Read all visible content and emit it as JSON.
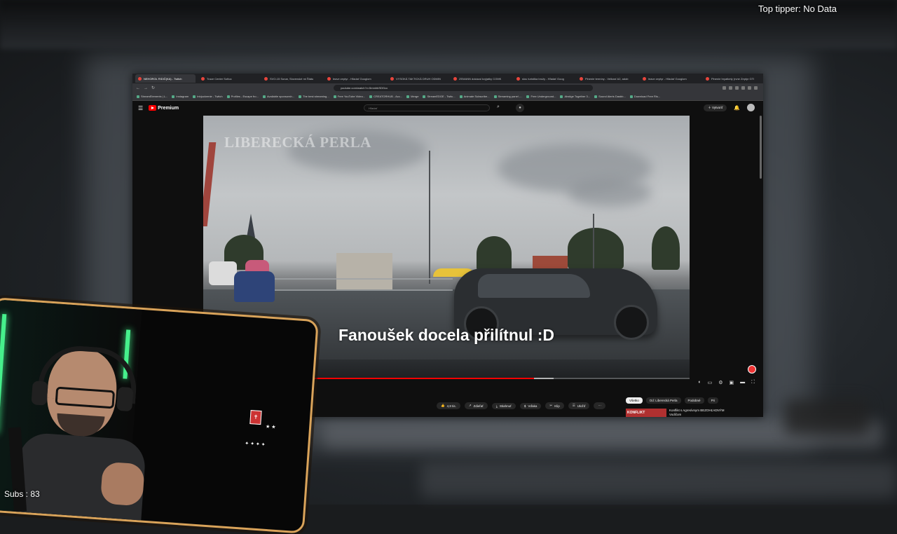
{
  "overlay": {
    "top_tipper": "Top tipper: No Data",
    "subs": "Subs : 83"
  },
  "browser": {
    "tabs": [
      {
        "label": "NEHOROL RIDIČ(KA) - Twitch",
        "active": true
      },
      {
        "label": "Trace Center Sofica",
        "active": false
      },
      {
        "label": "SVO-15 Sonar, Slovenské mi Štátu",
        "active": false
      },
      {
        "label": "leave zeptyr - Hľadať Googlom",
        "active": false
      },
      {
        "label": "VYSOKÁ TAKTICKÁ DRUH ODMIN",
        "active": false
      },
      {
        "label": "ZEMANN dokázal kvýjatky COMK",
        "active": false
      },
      {
        "label": "slou turistika brožy - Hľadať Goog",
        "active": false
      },
      {
        "label": "Plnenie termíny - Velkosť A2, adob",
        "active": false
      },
      {
        "label": "leave zeptyr - Hľadať Googlom",
        "active": false
      },
      {
        "label": "Plnenie hryatkety (rvne Zeptyr GTI",
        "active": false
      }
    ],
    "url": "youtube.com/watch?v=5mmhbSDf1vc",
    "bookmarks": [
      "StreamElements | L...",
      "Instagram",
      "Inbjuckrenie - Twitch",
      "Profiles - Escape fro...",
      "Available sponsorsh...",
      "The best streaming...",
      "Free YouTube Video...",
      "CREATORHUB - Acc...",
      "Merge",
      "StreamEDGE - Twitc...",
      "Animate Subscribe...",
      "Streaming panel -...",
      "Free Underground...",
      "Abstige Together 3...",
      "Sound Alerts Dasbb...",
      "Download Free Ris..."
    ]
  },
  "youtube": {
    "brand": "Premium",
    "search_placeholder": "Hľadať",
    "create_label": "Vytvoriť",
    "video": {
      "watermark": "LIBERECKÁ PERLA",
      "subtitle": "Fanoušek docela přilítnul :D",
      "progress": 0.68,
      "buffered": 0.72
    },
    "actions": [
      {
        "icon": "thumbs-up-icon",
        "label": "4,8 tis."
      },
      {
        "icon": "share-icon",
        "label": "Zdieľať"
      },
      {
        "icon": "download-icon",
        "label": "Stiahnuť"
      },
      {
        "icon": "thanks-icon",
        "label": "Vďaka"
      },
      {
        "icon": "clip-icon",
        "label": "Klip"
      },
      {
        "icon": "save-icon",
        "label": "Uložiť"
      }
    ],
    "chips": [
      {
        "label": "Všetko",
        "active": true
      },
      {
        "label": "Od: Liberecká Perla",
        "active": false
      },
      {
        "label": "Podobné",
        "active": false
      },
      {
        "label": "Pri",
        "active": false
      }
    ],
    "suggestion": {
      "thumb_text": "KONFLIKT",
      "title": "Konflikt s Agresívnym BEZOHĽADNÝM Vodičom"
    }
  },
  "colors": {
    "accent_red": "#ff0000",
    "webcam_border": "#d9a35a",
    "led_green": "#46f08c"
  }
}
